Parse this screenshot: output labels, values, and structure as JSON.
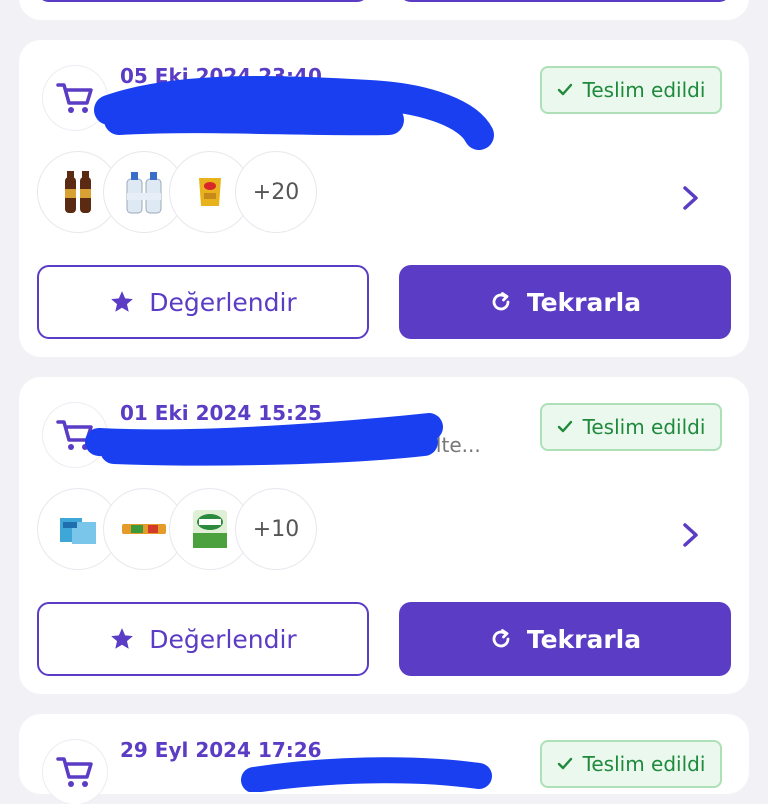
{
  "colors": {
    "accent": "#5b3cc4",
    "delivered_text": "#1f8a3b",
    "delivered_bg": "#eaf8ee",
    "redaction": "#1a3ff0"
  },
  "orders": [
    {
      "date": "05 Eki 2024 23:40",
      "subtitle": "",
      "status": "Teslim edildi",
      "more_count": "+20",
      "thumbs": [
        "cola-bottles-product",
        "water-bottles-product",
        "chips-bag-product"
      ],
      "rate_label": "Değerlendir",
      "repeat_label": "Tekrarla"
    },
    {
      "date": "01 Eki 2024 15:25",
      "subtitle": "halte...",
      "status": "Teslim edildi",
      "more_count": "+10",
      "thumbs": [
        "tissue-box-product",
        "snack-bar-product",
        "solo-paper-towel-product"
      ],
      "rate_label": "Değerlendir",
      "repeat_label": "Tekrarla"
    },
    {
      "date": "29 Eyl 2024 17:26",
      "status": "Teslim edildi"
    }
  ],
  "icons": {
    "cart": "cart-icon",
    "check": "check-icon",
    "star": "star-icon",
    "repeat": "repeat-icon",
    "chevron": "chevron-right-icon"
  }
}
